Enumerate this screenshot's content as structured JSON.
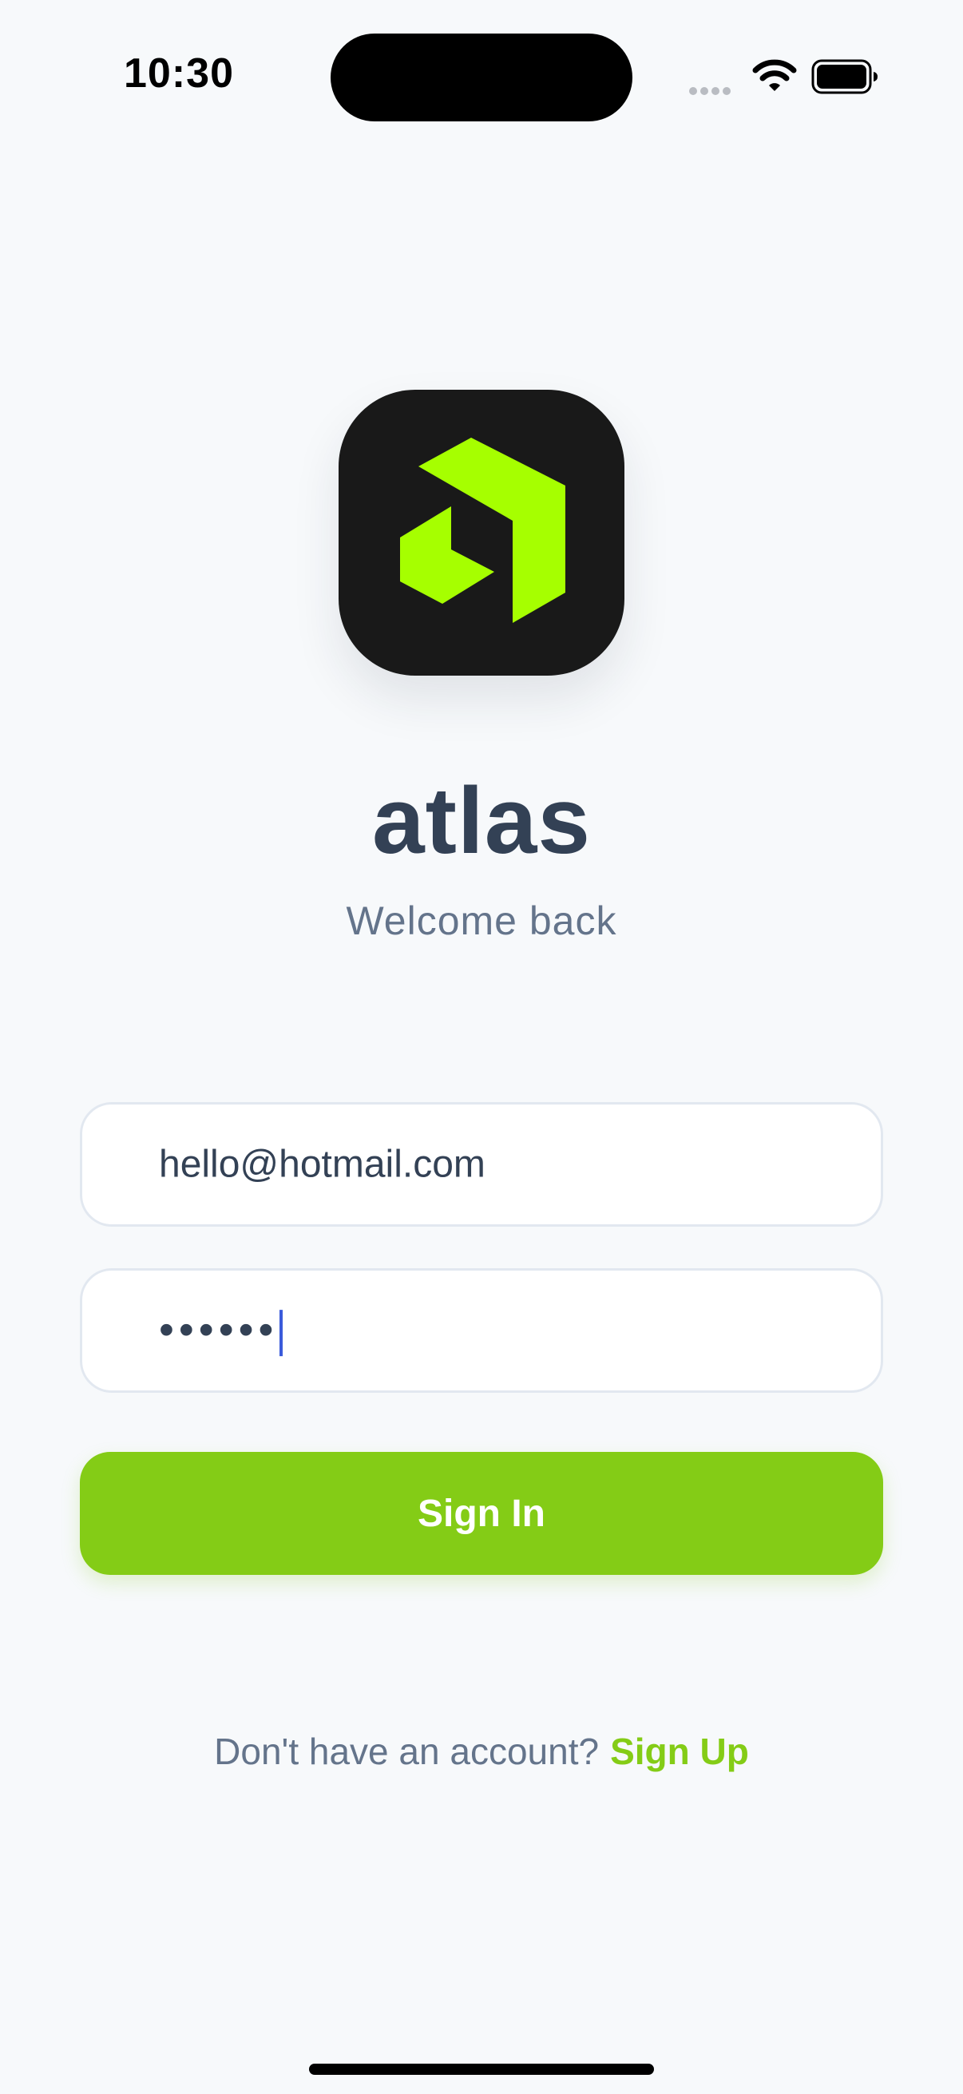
{
  "status_bar": {
    "time": "10:30"
  },
  "app": {
    "name": "atlas",
    "tagline": "Welcome back",
    "brand_color": "#84cc16",
    "icon_color": "#a6ff00"
  },
  "form": {
    "email_value": "hello@hotmail.com",
    "password_mask": "••••••"
  },
  "buttons": {
    "signin_label": "Sign In"
  },
  "footer": {
    "prompt": "Don't have an account?",
    "signup_label": "Sign Up"
  },
  "icons": {
    "status": [
      "cellular-signal-icon",
      "wifi-icon",
      "battery-icon"
    ],
    "logo": "atlas-logo-icon"
  }
}
